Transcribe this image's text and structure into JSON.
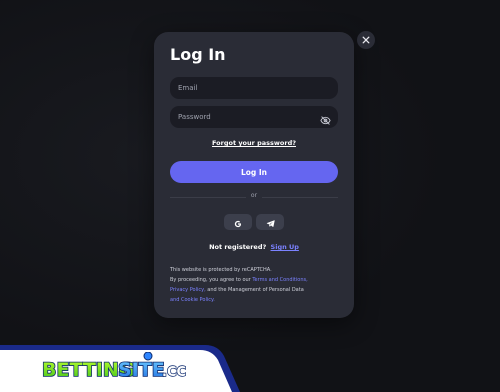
{
  "modal": {
    "title": "Log In",
    "email_placeholder": "Email",
    "password_placeholder": "Password",
    "forgot_label": "Forgot your password?",
    "login_label": "Log In",
    "or_label": "or",
    "signup_prompt": "Not registered?",
    "signup_link": "Sign Up",
    "legal_line1": "This website is protected by reCAPTCHA.",
    "legal_line2_prefix": "By proceeding, you agree to our",
    "legal_link1": "Terms and Conditions,",
    "legal_link2": "Privacy Policy,",
    "legal_mid": "and the Management of Personal Data",
    "legal_link3": "and Cookie Policy."
  },
  "icons": {
    "close": "close-icon",
    "eye": "eye-off-icon",
    "google": "google-icon",
    "telegram": "telegram-icon"
  },
  "brand": {
    "part1": "BETTING",
    "part2": "SITE",
    "tld": ".CC"
  },
  "colors": {
    "background": "#111216",
    "modal": "#2a2c36",
    "field": "#1b1c24",
    "accent": "#6566f0",
    "link": "#7b82ff"
  }
}
